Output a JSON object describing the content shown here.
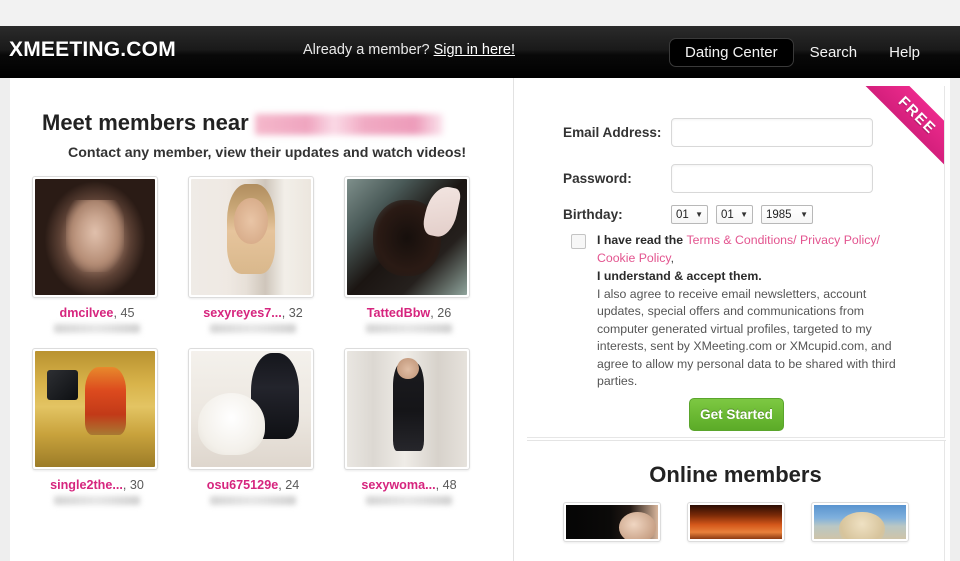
{
  "topbar": {
    "logo": "XMEETING.COM",
    "member_prompt": "Already a member?",
    "signin_link": "Sign in here!",
    "nav": [
      {
        "label": "Dating Center",
        "active": true
      },
      {
        "label": "Search",
        "active": false
      },
      {
        "label": "Help",
        "active": false
      }
    ]
  },
  "left": {
    "heading": "Meet members near",
    "heading_location_redacted": "",
    "subheading": "Contact any member, view their updates and watch videos!",
    "members": [
      {
        "name": "dmcilvee",
        "age": "45",
        "location_redacted": ""
      },
      {
        "name": "sexyreyes7...",
        "age": "32",
        "location_redacted": ""
      },
      {
        "name": "TattedBbw",
        "age": "26",
        "location_redacted": ""
      },
      {
        "name": "single2the...",
        "age": "30",
        "location_redacted": ""
      },
      {
        "name": "osu675129e",
        "age": "24",
        "location_redacted": ""
      },
      {
        "name": "sexywoma...",
        "age": "48",
        "location_redacted": ""
      }
    ]
  },
  "signup": {
    "ribbon": "FREE",
    "email_label": "Email Address:",
    "email_value": "",
    "email_placeholder": "",
    "password_label": "Password:",
    "password_value": "",
    "password_placeholder": "",
    "birthday_label": "Birthday:",
    "birthday_month": "01",
    "birthday_day": "01",
    "birthday_year": "1985",
    "caret": "▼",
    "terms_lead": "I have read the ",
    "terms_link_1": "Terms & Conditions/",
    "terms_link_2": " Privacy Policy/",
    "terms_link_3": "Cookie Policy",
    "terms_comma": ",",
    "terms_accept": "I understand & accept them.",
    "terms_body": "I also agree to receive email newsletters, account updates, special offers and communications from computer generated virtual profiles, targeted to my interests, sent by XMeeting.com or XMcupid.com, and agree to allow my personal data to be shared with third parties.",
    "get_started_label": "Get Started"
  },
  "online": {
    "title": "Online members",
    "members": [
      {
        "alt": "member-thumb-1"
      },
      {
        "alt": "member-thumb-2"
      },
      {
        "alt": "member-thumb-3"
      }
    ]
  },
  "colors": {
    "brand_pink": "#d6257e",
    "ribbon_pink": "#ec2a8c",
    "cta_green": "#6ab832",
    "topbar_black": "#000000",
    "link_pink": "#e3548f"
  }
}
